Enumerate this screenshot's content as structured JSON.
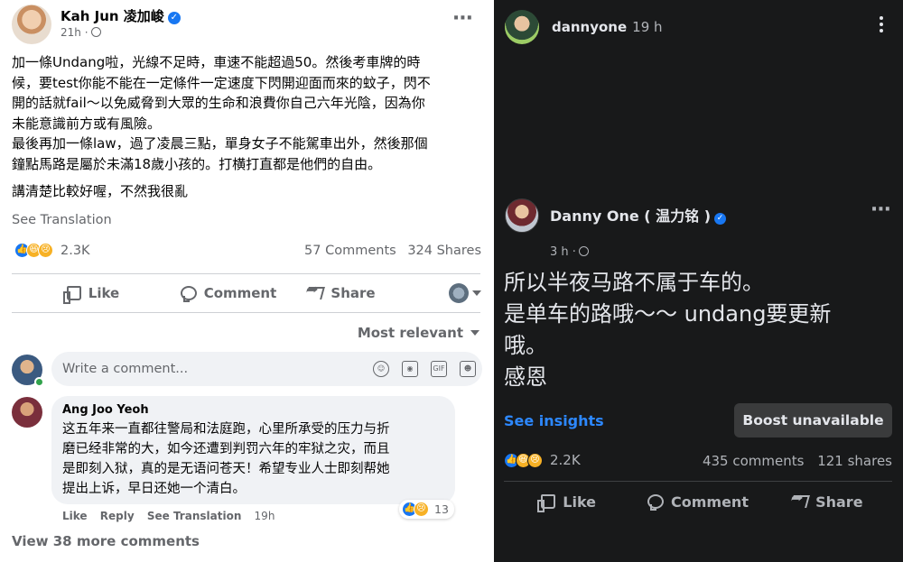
{
  "left_post": {
    "author": "Kah Jun 凌加峻",
    "time": "21h ·",
    "body": [
      "加一條Undang啦，光線不足時，車速不能超過50。然後考車牌的時\n候，要test你能不能在一定條件一定速度下閃開迎面而來的蚊子，閃不\n開的話就fail～以免威脅到大眾的生命和浪費你自己六年光陰，因為你\n未能意識前方或有風險。",
      "最後再加一條law，過了凌晨三點，單身女子不能駕車出外，然後那個\n鐘點馬路是屬於未滿18歲小孩的。打横打直都是他們的自由。",
      "講清楚比較好喔，不然我很亂"
    ],
    "see_translation": "See Translation",
    "reaction_count": "2.3K",
    "comments_count": "57 Comments",
    "shares_count": "324 Shares",
    "actions": {
      "like": "Like",
      "comment": "Comment",
      "share": "Share"
    },
    "sort": "Most relevant",
    "comment_placeholder": "Write a comment...",
    "comment": {
      "author": "Ang Joo Yeoh",
      "text": "这五年来一直都往警局和法庭跑，心里所承受的压力与折\n磨已经非常的大，如今还遭到判罚六年的牢狱之灾，而且\n是即刻入狱，真的是无语问苍天！希望专业人士即刻帮她\n提出上诉，早日还她一个清白。",
      "like": "Like",
      "reply": "Reply",
      "see_translation": "See Translation",
      "time": "19h",
      "reaction_count": "13"
    },
    "view_more": "View 38 more comments"
  },
  "right_post": {
    "sharer": "dannyone",
    "sharer_time": "19 h",
    "author": "Danny One ( 温力铭 )",
    "time": "3 h ·",
    "body": "所以半夜马路不属于车的。\n是单车的路哦～～ undang要更新\n哦。\n感恩",
    "see_insights": "See insights",
    "boost": "Boost unavailable",
    "reaction_count": "2.2K",
    "comments_count": "435 comments",
    "shares_count": "121 shares",
    "actions": {
      "like": "Like",
      "comment": "Comment",
      "share": "Share"
    }
  },
  "colors": {
    "facebook_blue": "#1877f2",
    "dark_bg": "#18191a",
    "insights_blue": "#2d88ff"
  }
}
